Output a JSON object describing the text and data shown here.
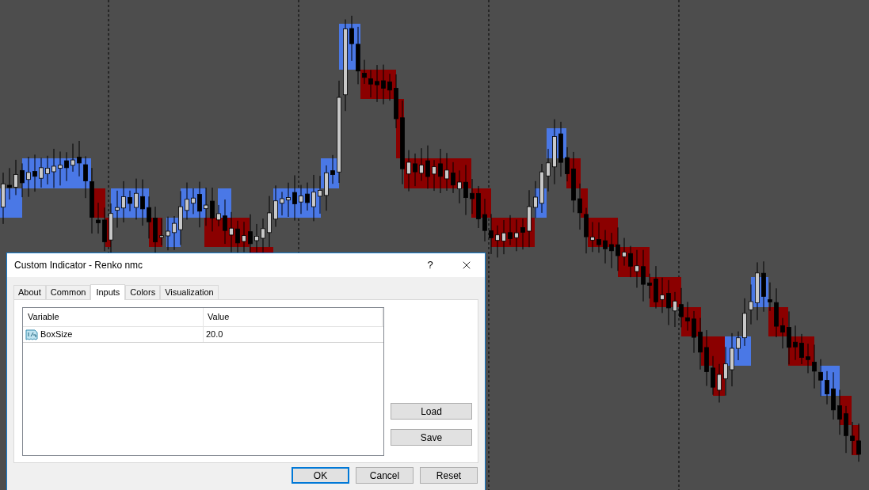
{
  "dialog": {
    "title": "Custom Indicator - Renko nmc",
    "help": "?",
    "tabs": [
      {
        "label": "About",
        "selected": false
      },
      {
        "label": "Common",
        "selected": false
      },
      {
        "label": "Inputs",
        "selected": true
      },
      {
        "label": "Colors",
        "selected": false
      },
      {
        "label": "Visualization",
        "selected": false
      }
    ],
    "table": {
      "columns": [
        "Variable",
        "Value"
      ],
      "rows": [
        {
          "variable": "BoxSize",
          "value": "20.0"
        }
      ]
    },
    "side_buttons": [
      "Load",
      "Save"
    ],
    "buttons": [
      {
        "label": "OK",
        "default": true
      },
      {
        "label": "Cancel",
        "default": false
      },
      {
        "label": "Reset",
        "default": false
      }
    ]
  }
}
